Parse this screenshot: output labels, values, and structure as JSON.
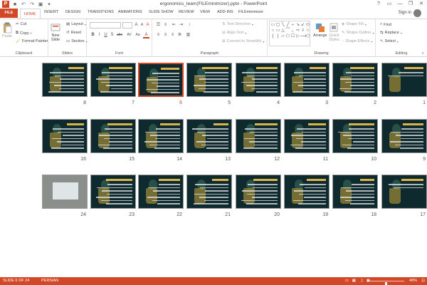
{
  "window": {
    "app_icon": "P",
    "title": "ergonomics_team(FILEminimizer).pptx - PowerPoint",
    "controls": [
      "?",
      "▭",
      "—",
      "❐",
      "✕"
    ]
  },
  "qat": {
    "save_icon": "floppy-icon",
    "undo": "↶",
    "redo": "↷",
    "present": "▣",
    "customize": "▾"
  },
  "tabs": [
    "FILE",
    "HOME",
    "INSERT",
    "DESIGN",
    "TRANSITIONS",
    "ANIMATIONS",
    "SLIDE SHOW",
    "REVIEW",
    "VIEW",
    "ADD-INS",
    "FILEminimizer"
  ],
  "active_tab": "HOME",
  "account": {
    "signin": "Sign in"
  },
  "ribbon": {
    "clipboard": {
      "label": "Clipboard",
      "paste": "Paste",
      "cut": "Cut",
      "copy": "Copy",
      "format_painter": "Format Painter"
    },
    "slides": {
      "label": "Slides",
      "new_slide": "New",
      "new_slide_2": "Slide",
      "layout": "Layout",
      "reset": "Reset",
      "section": "Section"
    },
    "font": {
      "label": "Font",
      "grow": "A",
      "shrink": "A",
      "clear": "A",
      "bold": "B",
      "italic": "I",
      "underline": "U",
      "strike": "S",
      "abc": "abc",
      "spacing": "AV",
      "case": "Aa",
      "color": "A"
    },
    "paragraph": {
      "label": "Paragraph",
      "text_direction": "Text Direction",
      "align_text": "Align Text",
      "convert_smartart": "Convert to SmartArt"
    },
    "drawing": {
      "label": "Drawing",
      "arrange": "Arrange",
      "quick_styles": "Quick",
      "quick_styles_2": "Styles",
      "shape_fill": "Shape Fill",
      "shape_outline": "Shape Outline",
      "shape_effects": "Shape Effects"
    },
    "editing": {
      "label": "Editing",
      "find": "Find",
      "replace": "Replace",
      "select": "Select"
    }
  },
  "shapes": [
    "▭",
    "▢",
    "╲",
    "╱",
    "⌐",
    "↘",
    "↙",
    "⬭",
    "○",
    "▭",
    "△",
    "⌒",
    "⌞",
    "⇨",
    "⇩",
    "☆",
    "{",
    "}",
    "▱",
    "⬠",
    "☐",
    "▷",
    "⟶",
    "⬡"
  ],
  "slides": {
    "selected": 6,
    "rows": [
      [
        1,
        2,
        3,
        4,
        5,
        6,
        7,
        8
      ],
      [
        9,
        10,
        11,
        12,
        13,
        14,
        15,
        16
      ],
      [
        17,
        18,
        19,
        20,
        21,
        22,
        23,
        24
      ]
    ]
  },
  "status": {
    "slide_info": "SLIDE 6 OF 24",
    "language": "PERSIAN",
    "zoom": "49%",
    "zoom_level": 0.49
  },
  "colors": {
    "accent": "#d24726",
    "slide_bg": "#0e2a2e"
  }
}
